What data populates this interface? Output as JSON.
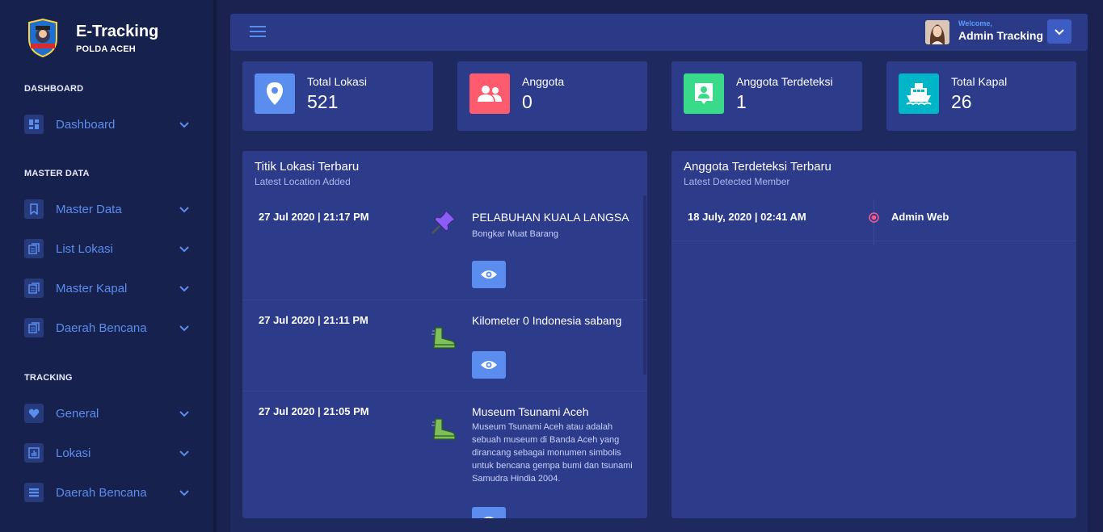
{
  "brand": {
    "title": "E-Tracking",
    "subtitle": "POLDA ACEH"
  },
  "sidebar": {
    "sections": [
      {
        "label": "DASHBOARD",
        "items": [
          {
            "label": "Dashboard",
            "icon": "dashboard-icon"
          }
        ]
      },
      {
        "label": "MASTER DATA",
        "items": [
          {
            "label": "Master Data",
            "icon": "bookmark-icon"
          },
          {
            "label": "List Lokasi",
            "icon": "copy-icon"
          },
          {
            "label": "Master Kapal",
            "icon": "copy-icon"
          },
          {
            "label": "Daerah Bencana",
            "icon": "copy-icon"
          }
        ]
      },
      {
        "label": "TRACKING",
        "items": [
          {
            "label": "General",
            "icon": "heart-icon"
          },
          {
            "label": "Lokasi",
            "icon": "bar-chart-icon"
          },
          {
            "label": "Daerah Bencana",
            "icon": "list-icon"
          }
        ]
      }
    ]
  },
  "header": {
    "welcome": "Welcome,",
    "user": "Admin Tracking"
  },
  "stats": [
    {
      "label": "Total Lokasi",
      "value": "521",
      "color": "#5a8dee",
      "icon": "map-marker-icon"
    },
    {
      "label": "Anggota",
      "value": "0",
      "color": "#ff5b6e",
      "icon": "users-icon"
    },
    {
      "label": "Anggota Terdeteksi",
      "value": "1",
      "color": "#39da8a",
      "icon": "contact-icon"
    },
    {
      "label": "Total Kapal",
      "value": "26",
      "color": "#00b5c8",
      "icon": "ship-icon"
    }
  ],
  "locations_panel": {
    "title": "Titik Lokasi Terbaru",
    "subtitle": "Latest Location Added",
    "items": [
      {
        "date": "27 Jul 2020 | 21:17 PM",
        "name": "PELABUHAN KUALA LANGSA",
        "desc": "Bongkar Muat Barang",
        "icon": "pushpin-icon"
      },
      {
        "date": "27 Jul 2020 | 21:11 PM",
        "name": "Kilometer 0 Indonesia sabang",
        "desc": "",
        "icon": "boot-icon"
      },
      {
        "date": "27 Jul 2020 | 21:05 PM",
        "name": "Museum Tsunami Aceh",
        "desc": "Museum Tsunami Aceh atau adalah sebuah museum di Banda Aceh yang dirancang sebagai monumen simbolis untuk bencana gempa bumi dan tsunami Samudra Hindia 2004.",
        "icon": "boot-icon"
      }
    ]
  },
  "members_panel": {
    "title": "Anggota Terdeteksi Terbaru",
    "subtitle": "Latest Detected Member",
    "items": [
      {
        "date": "18 July, 2020 | 02:41 AM",
        "name": "Admin Web"
      }
    ]
  },
  "colors": {
    "sidebar_bg": "#17214d",
    "panel_bg": "#2d3b8b",
    "accent": "#5a8dee"
  }
}
